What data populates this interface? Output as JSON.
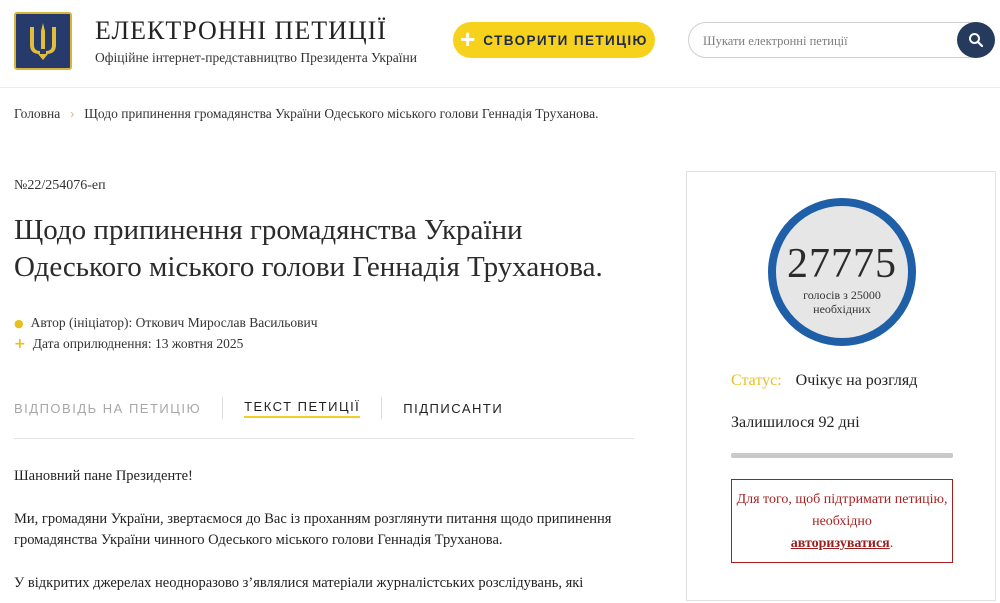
{
  "header": {
    "site_title": "ЕЛЕКТРОННІ ПЕТИЦІЇ",
    "site_subtitle": "Офіційне інтернет-представництво Президента України",
    "create_button": "СТВОРИТИ ПЕТИЦІЮ",
    "search_placeholder": "Шукати електронні петиції"
  },
  "breadcrumb": {
    "home": "Головна",
    "current": "Щодо припинення громадянства України Одеського міського голови Геннадія Труханова."
  },
  "petition": {
    "number": "№22/254076-еп",
    "title": "Щодо припинення громадянства України Одеського міського голови Геннадія Труханова.",
    "author": "Автор (ініціатор): Откович Мирослав Васильович",
    "date": "Дата оприлюднення: 13 жовтня 2025",
    "tabs": [
      "ВІДПОВІДЬ НА ПЕТИЦІЮ",
      "ТЕКСТ ПЕТИЦІЇ",
      "ПІДПИСАНТИ"
    ],
    "paragraphs": [
      "Шановний пане Президенте!",
      "Ми, громадяни України, звертаємося до Вас із проханням розглянути питання щодо припинення громадянства України чинного Одеського міського голови Геннадія Труханова.",
      "У відкритих джерелах неодноразово з’являлися матеріали журналістських розслідувань, які"
    ]
  },
  "sidebar": {
    "votes": "27775",
    "votes_caption_line1": "голосів з 25000",
    "votes_caption_line2": "необхідних",
    "status_label": "Статус:",
    "status_value": "Очікує на розгляд",
    "remaining": "Залишилося 92 дні",
    "auth_text": "Для того, щоб підтримати петицію, необхідно",
    "auth_link": "авторизуватися",
    "auth_suffix": "."
  },
  "colors": {
    "accent_yellow": "#f6d21c",
    "navy": "#263a5e",
    "counter_ring": "#1f5fa8",
    "alert_red": "#a52323"
  },
  "icons": {
    "logo": "trident-coat-of-arms-icon",
    "create": "plus-icon",
    "search": "search-icon",
    "author": "person-icon",
    "date": "plus-icon",
    "breadcrumb_separator": "chevron-right-icon"
  }
}
